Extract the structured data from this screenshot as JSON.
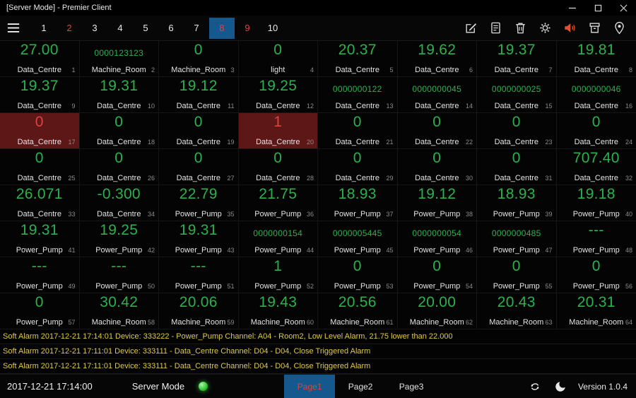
{
  "window": {
    "title": "[Server Mode] - Premier Client",
    "controls": [
      "minimize-icon",
      "maximize-icon",
      "close-icon"
    ]
  },
  "toolbar": {
    "pages": [
      {
        "label": "1",
        "state": "normal"
      },
      {
        "label": "2",
        "state": "alarm"
      },
      {
        "label": "3",
        "state": "normal"
      },
      {
        "label": "4",
        "state": "normal"
      },
      {
        "label": "5",
        "state": "normal"
      },
      {
        "label": "6",
        "state": "normal"
      },
      {
        "label": "7",
        "state": "normal"
      },
      {
        "label": "8",
        "state": "selected"
      },
      {
        "label": "9",
        "state": "alarm"
      },
      {
        "label": "10",
        "state": "normal"
      }
    ],
    "icons": [
      "edit-icon",
      "report-icon",
      "delete-icon",
      "settings-icon",
      "audio-alarm-icon",
      "clear-alarm-icon",
      "location-icon"
    ]
  },
  "tiles": [
    {
      "value": "27.00",
      "label": "Data_Centre",
      "index": "1",
      "state": "normal"
    },
    {
      "value": "0000123123",
      "label": "Machine_Room",
      "index": "2",
      "state": "normal"
    },
    {
      "value": "0",
      "label": "Machine_Room",
      "index": "3",
      "state": "normal"
    },
    {
      "value": "0",
      "label": "light",
      "index": "4",
      "state": "normal"
    },
    {
      "value": "20.37",
      "label": "Data_Centre",
      "index": "5",
      "state": "normal"
    },
    {
      "value": "19.62",
      "label": "Data_Centre",
      "index": "6",
      "state": "normal"
    },
    {
      "value": "19.37",
      "label": "Data_Centre",
      "index": "7",
      "state": "normal"
    },
    {
      "value": "19.81",
      "label": "Data_Centre",
      "index": "8",
      "state": "normal"
    },
    {
      "value": "19.37",
      "label": "Data_Centre",
      "index": "9",
      "state": "normal"
    },
    {
      "value": "19.31",
      "label": "Data_Centre",
      "index": "10",
      "state": "normal"
    },
    {
      "value": "19.12",
      "label": "Data_Centre",
      "index": "11",
      "state": "normal"
    },
    {
      "value": "19.25",
      "label": "Data_Centre",
      "index": "12",
      "state": "normal"
    },
    {
      "value": "0000000122",
      "label": "Data_Centre",
      "index": "13",
      "state": "normal"
    },
    {
      "value": "0000000045",
      "label": "Data_Centre",
      "index": "14",
      "state": "normal"
    },
    {
      "value": "0000000025",
      "label": "Data_Centre",
      "index": "15",
      "state": "normal"
    },
    {
      "value": "0000000046",
      "label": "Data_Centre",
      "index": "16",
      "state": "normal"
    },
    {
      "value": "0",
      "label": "Data_Centre",
      "index": "17",
      "state": "alarm"
    },
    {
      "value": "0",
      "label": "Data_Centre",
      "index": "18",
      "state": "normal"
    },
    {
      "value": "0",
      "label": "Data_Centre",
      "index": "19",
      "state": "normal"
    },
    {
      "value": "1",
      "label": "Data_Centre",
      "index": "20",
      "state": "alarm"
    },
    {
      "value": "0",
      "label": "Data_Centre",
      "index": "21",
      "state": "normal"
    },
    {
      "value": "0",
      "label": "Data_Centre",
      "index": "22",
      "state": "normal"
    },
    {
      "value": "0",
      "label": "Data_Centre",
      "index": "23",
      "state": "normal"
    },
    {
      "value": "0",
      "label": "Data_Centre",
      "index": "24",
      "state": "normal"
    },
    {
      "value": "0",
      "label": "Data_Centre",
      "index": "25",
      "state": "normal"
    },
    {
      "value": "0",
      "label": "Data_Centre",
      "index": "26",
      "state": "normal"
    },
    {
      "value": "0",
      "label": "Data_Centre",
      "index": "27",
      "state": "normal"
    },
    {
      "value": "0",
      "label": "Data_Centre",
      "index": "28",
      "state": "normal"
    },
    {
      "value": "0",
      "label": "Data_Centre",
      "index": "29",
      "state": "normal"
    },
    {
      "value": "0",
      "label": "Data_Centre",
      "index": "30",
      "state": "normal"
    },
    {
      "value": "0",
      "label": "Data_Centre",
      "index": "31",
      "state": "normal"
    },
    {
      "value": "707.40",
      "label": "Data_Centre",
      "index": "32",
      "state": "normal"
    },
    {
      "value": "26.071",
      "label": "Data_Centre",
      "index": "33",
      "state": "normal"
    },
    {
      "value": "-0.300",
      "label": "Data_Centre",
      "index": "34",
      "state": "normal"
    },
    {
      "value": "22.79",
      "label": "Power_Pump",
      "index": "35",
      "state": "normal"
    },
    {
      "value": "21.75",
      "label": "Power_Pump",
      "index": "36",
      "state": "normal"
    },
    {
      "value": "18.93",
      "label": "Power_Pump",
      "index": "37",
      "state": "normal"
    },
    {
      "value": "19.12",
      "label": "Power_Pump",
      "index": "38",
      "state": "normal"
    },
    {
      "value": "18.93",
      "label": "Power_Pump",
      "index": "39",
      "state": "normal"
    },
    {
      "value": "19.18",
      "label": "Power_Pump",
      "index": "40",
      "state": "normal"
    },
    {
      "value": "19.31",
      "label": "Power_Pump",
      "index": "41",
      "state": "normal"
    },
    {
      "value": "19.25",
      "label": "Power_Pump",
      "index": "42",
      "state": "normal"
    },
    {
      "value": "19.31",
      "label": "Power_Pump",
      "index": "43",
      "state": "normal"
    },
    {
      "value": "0000000154",
      "label": "Power_Pump",
      "index": "44",
      "state": "normal"
    },
    {
      "value": "0000005445",
      "label": "Power_Pump",
      "index": "45",
      "state": "normal"
    },
    {
      "value": "0000000054",
      "label": "Power_Pump",
      "index": "46",
      "state": "normal"
    },
    {
      "value": "0000000485",
      "label": "Power_Pump",
      "index": "47",
      "state": "normal"
    },
    {
      "value": "---",
      "label": "Power_Pump",
      "index": "48",
      "state": "normal"
    },
    {
      "value": "---",
      "label": "Power_Pump",
      "index": "49",
      "state": "normal"
    },
    {
      "value": "---",
      "label": "Power_Pump",
      "index": "50",
      "state": "normal"
    },
    {
      "value": "---",
      "label": "Power_Pump",
      "index": "51",
      "state": "normal"
    },
    {
      "value": "1",
      "label": "Power_Pump",
      "index": "52",
      "state": "normal"
    },
    {
      "value": "0",
      "label": "Power_Pump",
      "index": "53",
      "state": "normal"
    },
    {
      "value": "0",
      "label": "Power_Pump",
      "index": "54",
      "state": "normal"
    },
    {
      "value": "0",
      "label": "Power_Pump",
      "index": "55",
      "state": "normal"
    },
    {
      "value": "0",
      "label": "Power_Pump",
      "index": "56",
      "state": "normal"
    },
    {
      "value": "0",
      "label": "Power_Pump",
      "index": "57",
      "state": "normal"
    },
    {
      "value": "30.42",
      "label": "Machine_Room",
      "index": "58",
      "state": "normal"
    },
    {
      "value": "20.06",
      "label": "Machine_Room",
      "index": "59",
      "state": "normal"
    },
    {
      "value": "19.43",
      "label": "Machine_Room",
      "index": "60",
      "state": "normal"
    },
    {
      "value": "20.56",
      "label": "Machine_Room",
      "index": "61",
      "state": "normal"
    },
    {
      "value": "20.00",
      "label": "Machine_Room",
      "index": "62",
      "state": "normal"
    },
    {
      "value": "20.43",
      "label": "Machine_Room",
      "index": "63",
      "state": "normal"
    },
    {
      "value": "20.31",
      "label": "Machine_Room",
      "index": "64",
      "state": "normal"
    }
  ],
  "alarms": [
    "Soft Alarm 2017-12-21 17:14:01 Device: 333222 - Power_Pump Channel: A04 - Room2, Low Level Alarm, 21.75 lower than 22.000",
    "Soft Alarm 2017-12-21 17:11:01 Device: 333111 - Data_Centre Channel: D04 - D04, Close Triggered Alarm",
    "Soft Alarm 2017-12-21 17:11:01 Device: 333111 - Data_Centre Channel: D04 - D04, Close Triggered Alarm"
  ],
  "statusbar": {
    "timestamp": "2017-12-21 17:14:00",
    "mode_label": "Server Mode",
    "led_state": "green",
    "tabs": [
      {
        "label": "Page1",
        "selected": true
      },
      {
        "label": "Page2",
        "selected": false
      },
      {
        "label": "Page3",
        "selected": false
      }
    ],
    "icons": [
      "sync-icon",
      "night-mode-icon"
    ],
    "version": "Version 1.0.4"
  },
  "colors": {
    "green": "#2bb24c",
    "red": "#e04040",
    "yellow": "#dfca49",
    "blue": "#15588e",
    "alarm_bg": "#5e1717",
    "speaker": "#e0512f"
  }
}
